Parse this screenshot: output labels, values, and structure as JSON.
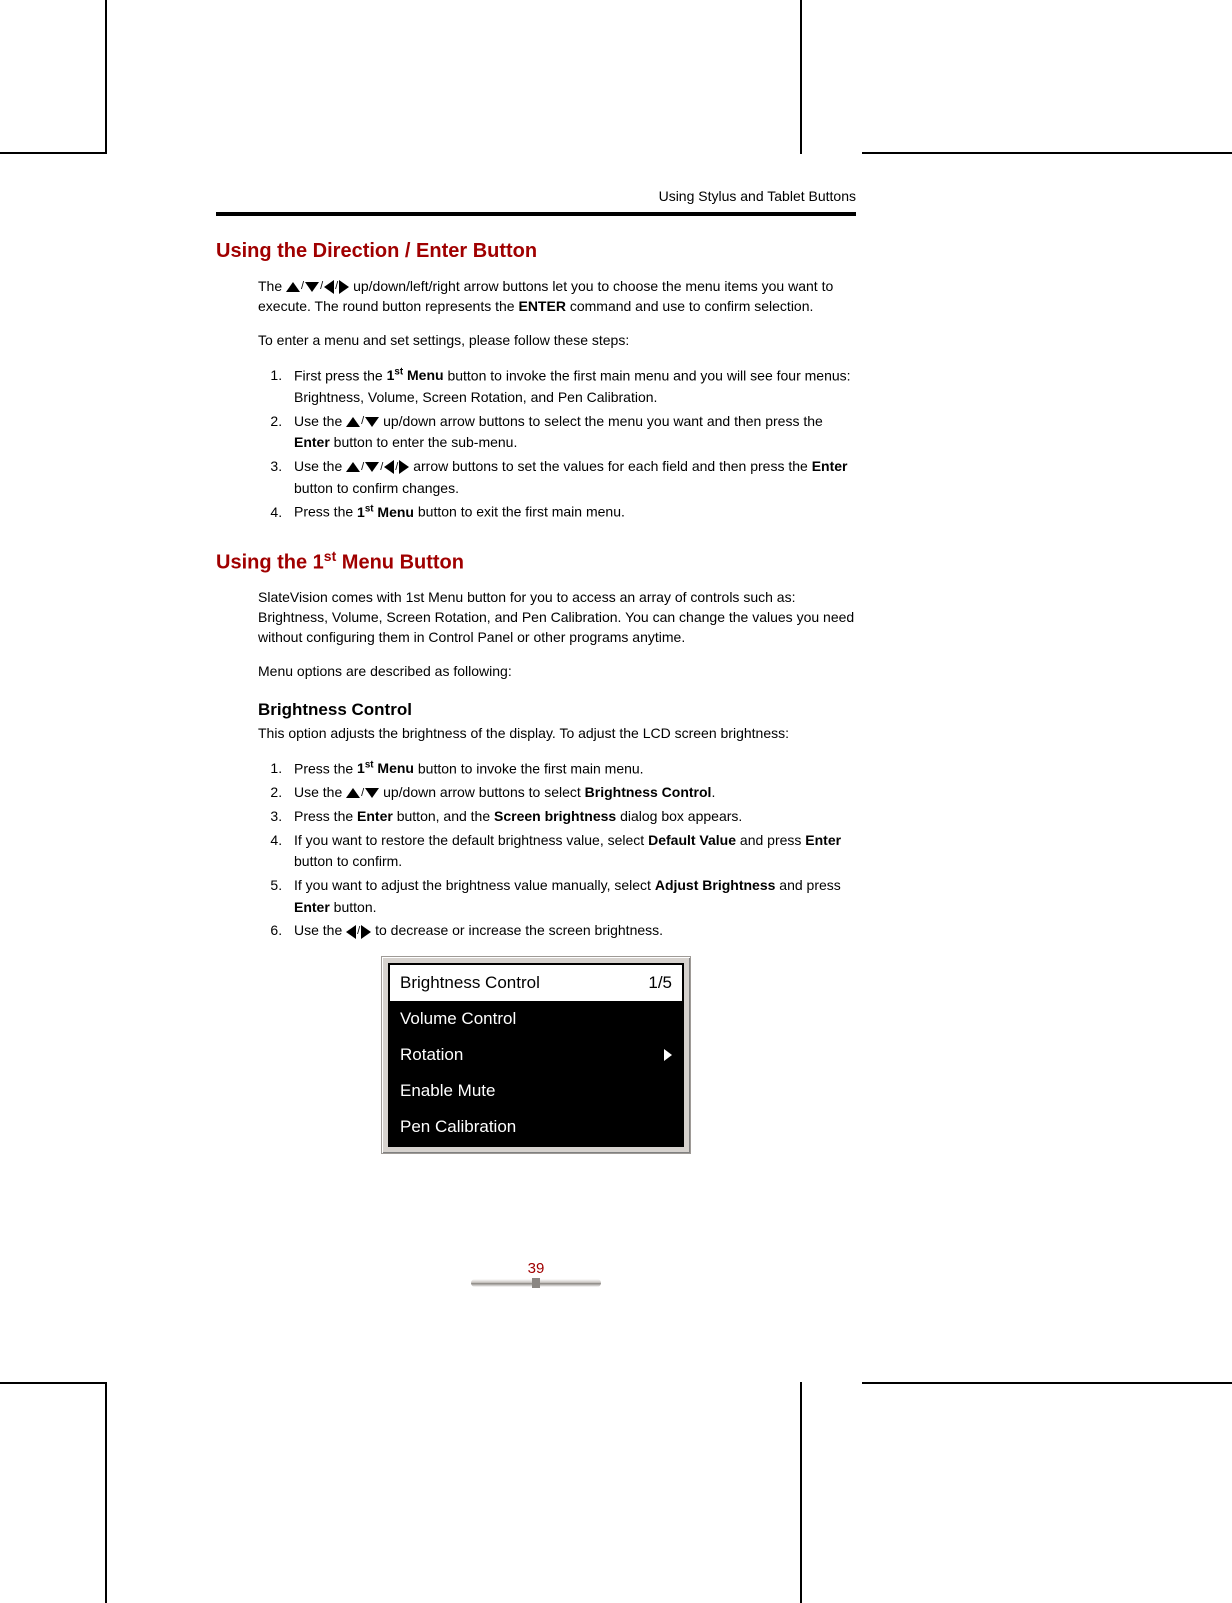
{
  "header": "Using Stylus and Tablet Buttons",
  "section1_title": "Using the Direction / Enter Button",
  "s1_intro_a": "The ",
  "s1_intro_b": " up/down/left/right arrow buttons let you to choose the menu items you want to execute. The round button represents the ",
  "s1_intro_enter": "ENTER",
  "s1_intro_c": " command and use to confirm selection.",
  "s1_lead": "To enter a menu and set settings, please follow these steps:",
  "s1_steps": {
    "1a": "First press the ",
    "1b": "1",
    "1sup": "st",
    "1c": " Menu",
    "1d": " button to invoke the first main menu and you will see four menus: Brightness, Volume, Screen Rotation, and Pen Calibration.",
    "2a": "Use the ",
    "2b": " up/down arrow buttons to select the menu you want and then press the ",
    "2c": "Enter",
    "2d": " button to enter the sub-menu.",
    "3a": "Use the ",
    "3b": " arrow buttons to set the values for each field and then press the ",
    "3c": "Enter",
    "3d": " button to confirm changes.",
    "4a": "Press the ",
    "4b": "1",
    "4sup": "st",
    "4c": " Menu",
    "4d": " button to exit the first main menu."
  },
  "section2_title_a": "Using the 1",
  "section2_title_sup": "st",
  "section2_title_b": " Menu Button",
  "s2_intro": "SlateVision comes with 1st Menu button for you to access an array of controls such as: Brightness, Volume, Screen Rotation, and Pen Calibration.  You can change the values you need without configuring them in Control Panel or other programs anytime.",
  "s2_lead": "Menu options are described as following:",
  "sub_brightness": "Brightness Control",
  "bc_intro": "This option adjusts the brightness of the display.  To adjust the LCD screen brightness:",
  "bc": {
    "1a": "Press the ",
    "1b": "1",
    "1sup": "st",
    "1c": " Menu",
    "1d": " button to invoke the first main menu.",
    "2a": "Use the ",
    "2b": " up/down arrow buttons to select ",
    "2c": "Brightness Control",
    "2d": ".",
    "3a": "Press the ",
    "3b": "Enter",
    "3c": " button, and the ",
    "3d": "Screen brightness",
    "3e": " dialog box appears.",
    "4a": "If you want to restore the default brightness value, select ",
    "4b": "Default Value",
    "4c": " and press ",
    "4d": "Enter",
    "4e": " button to confirm.",
    "5a": "If you want to adjust the brightness value manually, select ",
    "5b": "Adjust Brightness",
    "5c": " and press ",
    "5d": "Enter",
    "5e": " button.",
    "6a": "Use the ",
    "6b": " to decrease or increase the screen brightness."
  },
  "menu": {
    "item1": "Brightness Control",
    "count": "1/5",
    "item2": "Volume Control",
    "item3": "Rotation",
    "item4": "Enable Mute",
    "item5": "Pen Calibration"
  },
  "page_num": "39"
}
